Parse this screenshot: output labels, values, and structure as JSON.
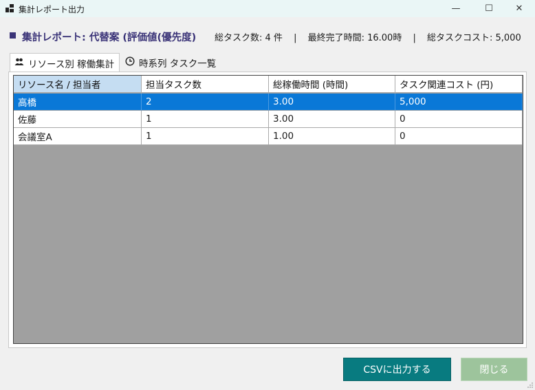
{
  "window": {
    "title": "集計レポート出力",
    "controls": {
      "minimize": "—",
      "maximize": "☐",
      "close": "✕"
    }
  },
  "header": {
    "title": "集計レポート: 代替案 (評価値(優先度)",
    "stats": [
      "総タスク数: 4 件",
      "|",
      "最終完了時間: 16.00時",
      "|",
      "総タスクコスト: 5,000"
    ]
  },
  "tabs": [
    {
      "label": "リソース別 稼働集計",
      "icon": "people-icon",
      "active": true
    },
    {
      "label": "時系列 タスク一覧",
      "icon": "clock-icon",
      "active": false
    }
  ],
  "table": {
    "columns": [
      "リソース名 / 担当者",
      "担当タスク数",
      "総稼働時間 (時間)",
      "タスク関連コスト (円)"
    ],
    "rows": [
      [
        "高橋",
        "2",
        "3.00",
        "5,000"
      ],
      [
        "佐藤",
        "1",
        "3.00",
        "0"
      ],
      [
        "会議室A",
        "1",
        "1.00",
        "0"
      ]
    ],
    "selected_row": 0
  },
  "buttons": {
    "csv": "CSVに出力する",
    "close": "閉じる"
  },
  "colors": {
    "accent": "#3b3478",
    "selection": "#0a78d7",
    "csv_button": "#087b80",
    "close_button": "#9dc49c",
    "grid_background": "#a0a0a0"
  }
}
